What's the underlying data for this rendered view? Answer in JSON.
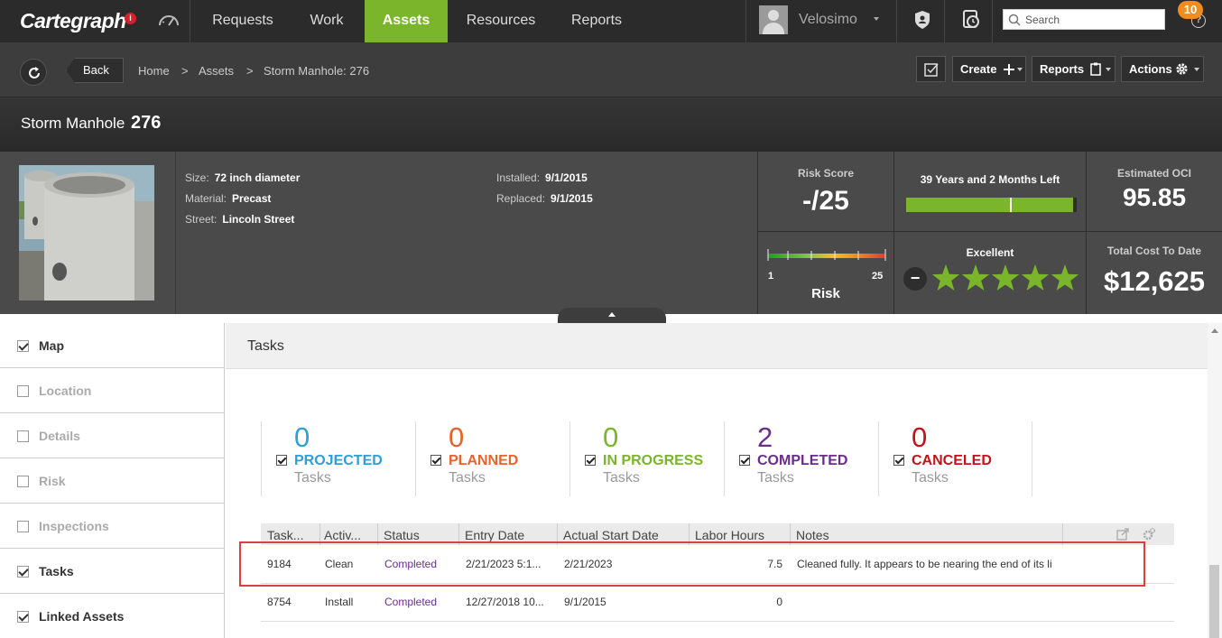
{
  "nav": {
    "logo": "Cartegraph",
    "logo_badge": "i",
    "items": [
      "Requests",
      "Work",
      "Assets",
      "Resources",
      "Reports"
    ],
    "active_index": 2,
    "username": "Velosimo",
    "search_placeholder": "Search",
    "notification_count": "10",
    "help": "?",
    "accent_color": "#7ab52b"
  },
  "toolbar": {
    "back": "Back",
    "breadcrumb": [
      "Home",
      ">",
      "Assets",
      ">",
      "Storm Manhole: 276"
    ],
    "create": "Create",
    "reports": "Reports",
    "actions": "Actions"
  },
  "title": {
    "type": "Storm Manhole",
    "id": "276"
  },
  "summary": {
    "details": [
      {
        "label": "Size:",
        "value": "72 inch diameter"
      },
      {
        "label": "Material:",
        "value": "Precast"
      },
      {
        "label": "Street:",
        "value": "Lincoln Street"
      }
    ],
    "dates": [
      {
        "label": "Installed:",
        "value": "9/1/2015"
      },
      {
        "label": "Replaced:",
        "value": "9/1/2015"
      }
    ],
    "risk_score_label": "Risk Score",
    "risk_score_value": "-/25",
    "life_label": "39 Years and 2 Months Left",
    "life_fraction": 0.98,
    "oci_label": "Estimated OCI",
    "oci_value": "95.85",
    "risk_min": "1",
    "risk_max": "25",
    "risk_label": "Risk",
    "condition_label": "Excellent",
    "condition_stars": 5,
    "minus": "−",
    "cost_label": "Total Cost To Date",
    "cost_value": "$12,625"
  },
  "sidebar": [
    {
      "label": "Map",
      "checked": true
    },
    {
      "label": "Location",
      "checked": false
    },
    {
      "label": "Details",
      "checked": false
    },
    {
      "label": "Risk",
      "checked": false
    },
    {
      "label": "Inspections",
      "checked": false
    },
    {
      "label": "Tasks",
      "checked": true
    },
    {
      "label": "Linked Assets",
      "checked": true
    }
  ],
  "tasks": {
    "header": "Tasks",
    "stats": [
      {
        "count": "0",
        "name": "PROJECTED",
        "sub": "Tasks",
        "color": "#2e9fd8"
      },
      {
        "count": "0",
        "name": "PLANNED",
        "sub": "Tasks",
        "color": "#e8632b"
      },
      {
        "count": "0",
        "name": "IN PROGRESS",
        "sub": "Tasks",
        "color": "#7ab52b"
      },
      {
        "count": "2",
        "name": "COMPLETED",
        "sub": "Tasks",
        "color": "#6a2d8f"
      },
      {
        "count": "0",
        "name": "CANCELED",
        "sub": "Tasks",
        "color": "#c4121a"
      }
    ],
    "columns": [
      "Task...",
      "Activ...",
      "Status",
      "Entry Date",
      "Actual Start Date",
      "Labor Hours",
      "Notes"
    ],
    "rows": [
      [
        "9184",
        "Clean",
        "Completed",
        "2/21/2023 5:1...",
        "2/21/2023",
        "7.5",
        "Cleaned fully. It appears to be nearing the end of its li"
      ],
      [
        "8754",
        "Install",
        "Completed",
        "12/27/2018 10...",
        "9/1/2015",
        "0",
        ""
      ]
    ],
    "status_color": "#6a2d8f"
  }
}
